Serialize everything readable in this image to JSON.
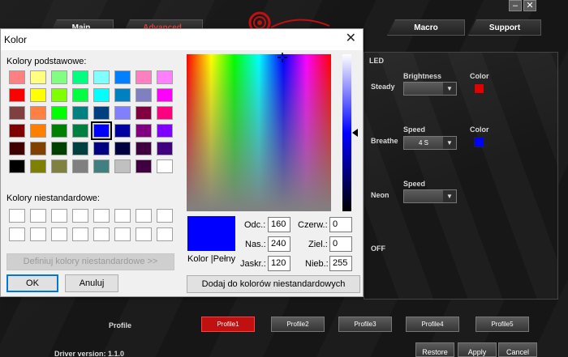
{
  "app": {
    "window_controls": {
      "minimize": "–",
      "close": "✕"
    },
    "tabs": [
      {
        "label": "Main"
      },
      {
        "label": "Advanced"
      },
      {
        "label": "Macro"
      },
      {
        "label": "Support"
      }
    ],
    "led": {
      "title": "LED",
      "modes": {
        "steady": "Steady",
        "breathe": "Breathe",
        "neon": "Neon",
        "off": "OFF"
      },
      "brightness_label": "Brightness",
      "brightness_value": "",
      "speed_label": "Speed",
      "breathe_speed_value": "4 S",
      "neon_speed_value": "",
      "color_label": "Color",
      "steady_color": "#e00000",
      "breathe_color": "#0000ff"
    },
    "profile": {
      "label": "Profile",
      "buttons": [
        "Profile1",
        "Profile2",
        "Profile3",
        "Profile4",
        "Profile5"
      ],
      "active_index": 0,
      "active_color": "#c01010"
    },
    "driver_version": "Driver version:  1.1.0",
    "bottom_buttons": {
      "restore": "Restore",
      "apply": "Apply",
      "cancel": "Cancel"
    }
  },
  "dialog": {
    "title": "Kolor",
    "basic_colors_label": "Kolory podstawowe:",
    "basic_colors": [
      "#ff8080",
      "#ffff80",
      "#80ff80",
      "#00ff80",
      "#80ffff",
      "#0080ff",
      "#ff80c0",
      "#ff80ff",
      "#ff0000",
      "#ffff00",
      "#80ff00",
      "#00ff40",
      "#00ffff",
      "#0080c0",
      "#8080c0",
      "#ff00ff",
      "#804040",
      "#ff8040",
      "#00ff00",
      "#008080",
      "#004080",
      "#8080ff",
      "#800040",
      "#ff0080",
      "#800000",
      "#ff8000",
      "#008000",
      "#008040",
      "#0000ff",
      "#0000a0",
      "#800080",
      "#8000ff",
      "#400000",
      "#804000",
      "#004000",
      "#004040",
      "#000080",
      "#000040",
      "#400040",
      "#400080",
      "#000000",
      "#808000",
      "#808040",
      "#808080",
      "#408080",
      "#c0c0c0",
      "#400040",
      "#ffffff"
    ],
    "selected_basic_index": 28,
    "custom_colors_label": "Kolory niestandardowe:",
    "define_custom_button": "Definiuj kolory niestandardowe >>",
    "ok_button": "OK",
    "cancel_button": "Anuluj",
    "current_color": "#0000ff",
    "color_solid_label": "Kolor |Pełny",
    "fields": {
      "hue_label": "Odc.:",
      "hue": "160",
      "sat_label": "Nas.:",
      "sat": "240",
      "lum_label": "Jaskr.:",
      "lum": "120",
      "red_label": "Czerw.:",
      "red": "0",
      "green_label": "Ziel.:",
      "green": "0",
      "blue_label": "Nieb.:",
      "blue": "255"
    },
    "add_custom_button": "Dodaj do kolorów niestandardowych"
  }
}
